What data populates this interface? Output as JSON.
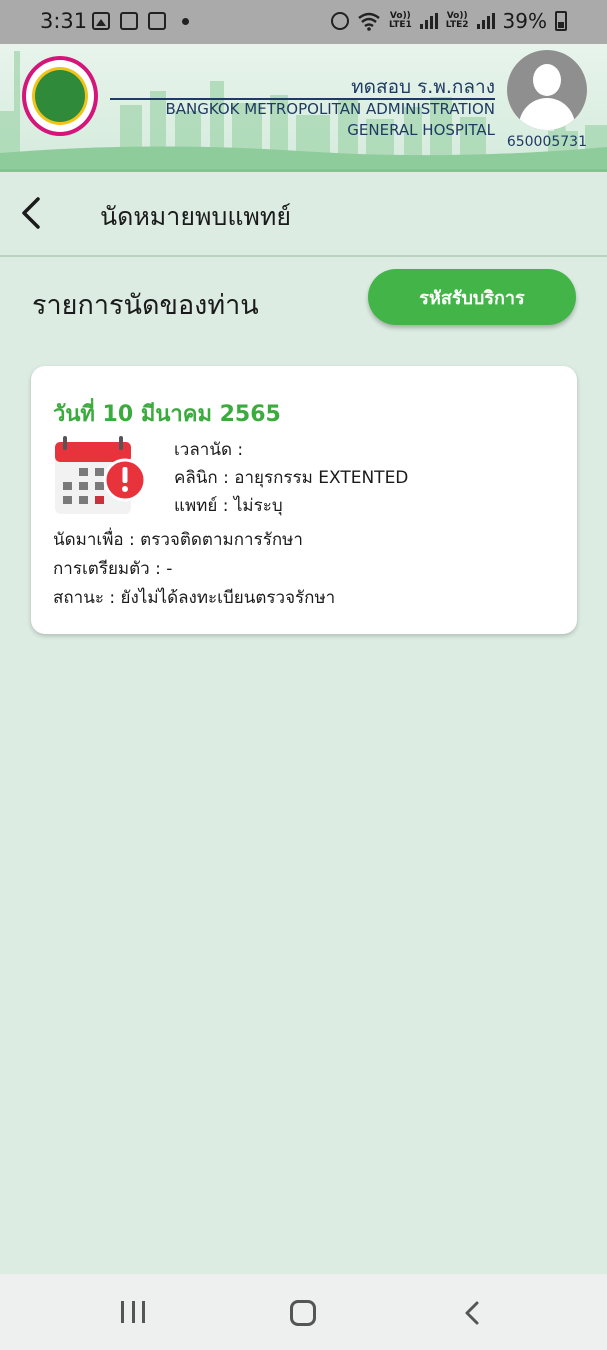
{
  "status_bar": {
    "time": "3:31",
    "lte1": "LTE1",
    "lte2": "LTE2",
    "volte": "Vo))",
    "battery": "39%"
  },
  "header": {
    "hospital_name_th": "ทดสอบ ร.พ.กลาง",
    "hospital_name_en_1": "BANGKOK METROPOLITAN ADMINISTRATION",
    "hospital_name_en_2": "GENERAL HOSPITAL",
    "patient_id": "650005731"
  },
  "page": {
    "title": "นัดหมายพบแพทย์",
    "list_title": "รายการนัดของท่าน",
    "service_code_button": "รหัสรับบริการ"
  },
  "appointment": {
    "date": "วันที่ 10 มีนาคม 2565",
    "time_label": "เวลานัด :",
    "clinic_label": "คลินิก : อายุรกรรม EXTENTED",
    "doctor_label": "แพทย์ : ไม่ระบุ",
    "purpose_label": "นัดมาเพื่อ : ตรวจติดตามการรักษา",
    "preparation_label": "การเตรียมตัว : -",
    "status_label": "สถานะ : ยังไม่ได้ลงทะเบียนตรวจรักษา"
  },
  "colors": {
    "accent_green": "#43b548",
    "date_green": "#3bab3e",
    "background": "#dcece2",
    "navy": "#1f3b63",
    "logo_pink": "#d4157a",
    "alert_red": "#e8323c"
  },
  "icons": [
    "gallery-icon",
    "voicemail-icon",
    "home-alert-icon",
    "alarm-icon",
    "wifi-icon",
    "signal-icon",
    "battery-icon",
    "back-arrow-icon",
    "calendar-alert-icon",
    "recent-apps-icon",
    "home-icon",
    "nav-back-icon"
  ]
}
